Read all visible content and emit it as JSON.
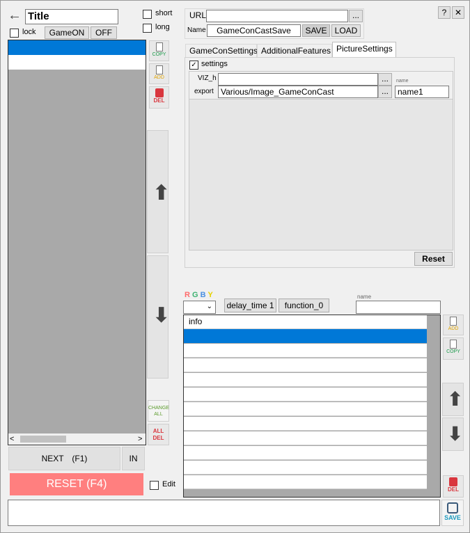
{
  "header": {
    "back_arrow": "←",
    "title_value": "Title",
    "lock_label": "lock",
    "gameon_label": "GameON",
    "off_label": "OFF",
    "short_label": "short",
    "long_label": "long"
  },
  "window_controls": {
    "help": "?",
    "close": "✕"
  },
  "url_section": {
    "url_label": "URL",
    "url_value": "",
    "browse": "...",
    "name_label": "Name",
    "name_value": "GameConCastSave",
    "save_label": "SAVE",
    "load_label": "LOAD"
  },
  "tabs": [
    {
      "label": "GameConSettings"
    },
    {
      "label": "AdditionalFeatures"
    },
    {
      "label": "PictureSettings"
    }
  ],
  "picture_settings": {
    "settings_label": "settings",
    "settings_checked": true,
    "viz_label": "VIZ_h",
    "viz_value": "",
    "viz_browse": "...",
    "name_hint": "name",
    "export_label": "export",
    "export_value": "Various/Image_GameConCast",
    "export_browse": "...",
    "name_value": "name1",
    "reset_label": "Reset"
  },
  "side_icons": {
    "copy": "COPY",
    "add": "ADD",
    "del": "DEL",
    "all_del": "ALL DEL",
    "change_all": "CHANGE ALL"
  },
  "bottom_left": {
    "next_label": "NEXT　(F1)",
    "in_label": "IN",
    "reset_label": "RESET (F4)",
    "edit_label": "Edit"
  },
  "rgby": {
    "r": "R",
    "g": "G",
    "b": "B",
    "y": "Y"
  },
  "function_bar": {
    "delay_label": "delay_time 1",
    "function_label": "function_0",
    "name_hint": "name",
    "name_value": ""
  },
  "info_list": {
    "header": "info"
  },
  "bottom": {
    "save_label": "SAVE",
    "text_value": ""
  },
  "colors": {
    "selection": "#0078d7",
    "reset_button": "#ff7f7f",
    "list_bg": "#a9a9a9",
    "delete_red": "#d9363e"
  }
}
